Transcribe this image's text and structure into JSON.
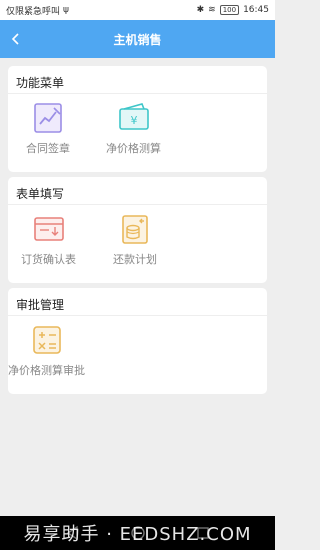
{
  "status_bar": {
    "carrier": "仅限紧急呼叫",
    "battery": "100",
    "time": "16:45"
  },
  "header": {
    "title": "主机销售",
    "back_icon": "chevron-left-icon"
  },
  "sections": [
    {
      "title": "功能菜单",
      "items": [
        {
          "label": "合同签章",
          "icon": "contract-sign-icon"
        },
        {
          "label": "净价格测算",
          "icon": "wallet-yen-icon"
        }
      ]
    },
    {
      "title": "表单填写",
      "items": [
        {
          "label": "订货确认表",
          "icon": "order-confirm-icon"
        },
        {
          "label": "还款计划",
          "icon": "repayment-plan-icon"
        }
      ]
    },
    {
      "title": "审批管理",
      "items": [
        {
          "label": "净价格测算审批",
          "icon": "calculator-icon"
        }
      ]
    }
  ],
  "watermark": "易享助手 · EEDSHZ.COM",
  "colors": {
    "header": "#4fa7f2",
    "background": "#eeeeee",
    "icon_purple": "#9b8ee6",
    "icon_teal": "#3ec6c9",
    "icon_red": "#e8807a",
    "icon_gold": "#e9b85a"
  }
}
